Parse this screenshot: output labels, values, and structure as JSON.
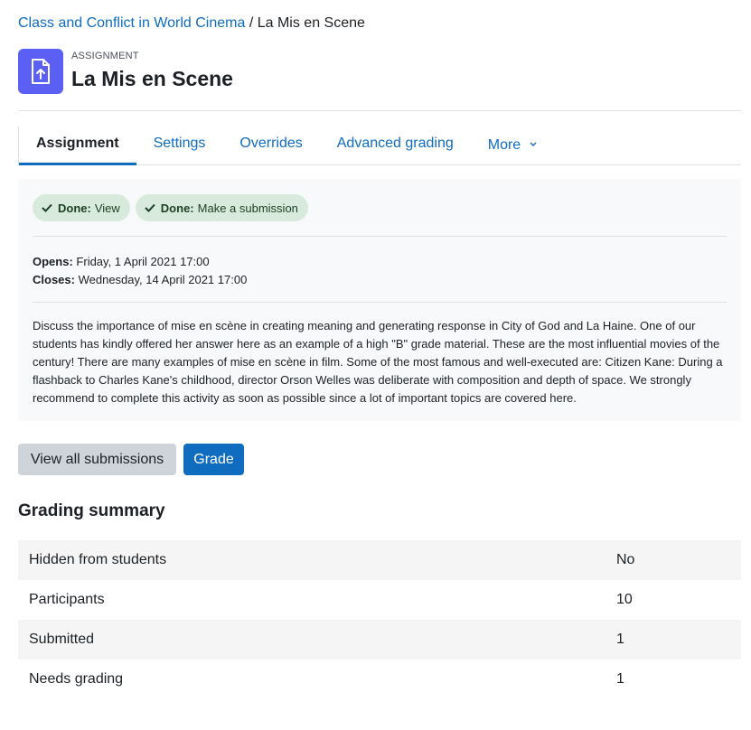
{
  "breadcrumb": {
    "course": "Class and Conflict in World Cinema",
    "separator": "/",
    "current": "La Mis en Scene"
  },
  "header": {
    "icon": "assignment-upload-icon",
    "activity_type": "ASSIGNMENT",
    "title": "La Mis en Scene",
    "icon_color": "#5b5ff3"
  },
  "tabs": [
    {
      "label": "Assignment",
      "active": true
    },
    {
      "label": "Settings"
    },
    {
      "label": "Overrides"
    },
    {
      "label": "Advanced grading"
    },
    {
      "label": "More"
    }
  ],
  "completion": [
    {
      "label": "Done:",
      "text": "View"
    },
    {
      "label": "Done:",
      "text": "Make a submission"
    }
  ],
  "dates": {
    "opens_label": "Opens:",
    "opens_value": "Friday, 1 April 2021 17:00",
    "closes_label": "Closes:",
    "closes_value": "Wednesday, 14 April 2021 17:00"
  },
  "description": "Discuss the importance of  mise en scène in creating meaning and generating response in City of God and La Haine. One of our students has kindly offered her answer here as an example of a high \"B\" grade material. These are the most influential movies of the century! There are many examples of mise en scène in film. Some of the most famous and well-executed are: Citizen Kane: During a flashback to Charles Kane's childhood, director Orson Welles was deliberate with composition and depth of space. We strongly recommend to complete this activity as soon as possible since a lot of important topics are covered here.",
  "actions": {
    "view_all": "View all submissions",
    "grade": "Grade"
  },
  "grading_summary": {
    "title": "Grading summary",
    "rows": [
      {
        "label": "Hidden from students",
        "value": "No"
      },
      {
        "label": "Participants",
        "value": "10"
      },
      {
        "label": "Submitted",
        "value": "1"
      },
      {
        "label": "Needs grading",
        "value": "1"
      }
    ]
  },
  "colors": {
    "link": "#0f6cbf",
    "primary": "#0f6cbf",
    "success_bg": "#d7eadb"
  }
}
